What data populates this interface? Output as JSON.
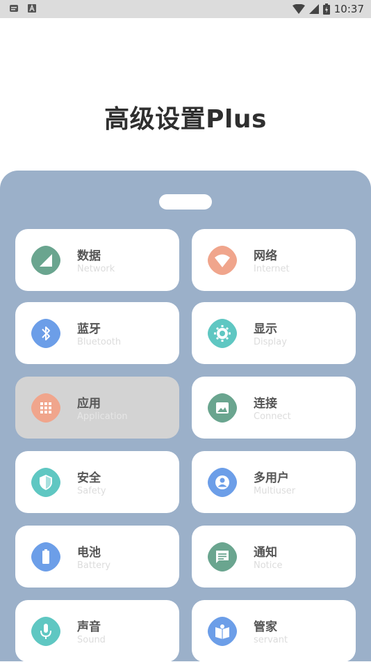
{
  "status_bar": {
    "time": "10:37",
    "icons": [
      "message-icon",
      "a-icon",
      "wifi-icon",
      "signal-icon",
      "battery-icon"
    ]
  },
  "page": {
    "title": "高级设置Plus"
  },
  "colors": {
    "panel": "#9bb0c9",
    "card": "#ffffff",
    "card_active": "#d3d3d3",
    "green": "#6aa58f",
    "orange": "#f0a58c",
    "blue": "#6c9ee8",
    "teal": "#5fc7c2"
  },
  "settings": [
    {
      "title": "数据",
      "subtitle": "Network",
      "icon": "network-icon",
      "color": "#6aa58f"
    },
    {
      "title": "网络",
      "subtitle": "Internet",
      "icon": "wifi-icon",
      "color": "#f0a58c"
    },
    {
      "title": "蓝牙",
      "subtitle": "Bluetooth",
      "icon": "bluetooth-icon",
      "color": "#6c9ee8"
    },
    {
      "title": "显示",
      "subtitle": "Display",
      "icon": "brightness-icon",
      "color": "#5fc7c2"
    },
    {
      "title": "应用",
      "subtitle": "Application",
      "icon": "apps-grid-icon",
      "color": "#f0a58c",
      "active": true
    },
    {
      "title": "连接",
      "subtitle": "Connect",
      "icon": "image-icon",
      "color": "#6aa58f"
    },
    {
      "title": "安全",
      "subtitle": "Safety",
      "icon": "shield-icon",
      "color": "#5fc7c2"
    },
    {
      "title": "多用户",
      "subtitle": "Multiuser",
      "icon": "user-icon",
      "color": "#6c9ee8"
    },
    {
      "title": "电池",
      "subtitle": "Battery",
      "icon": "battery-icon",
      "color": "#6c9ee8"
    },
    {
      "title": "通知",
      "subtitle": "Notice",
      "icon": "message-icon",
      "color": "#6aa58f"
    },
    {
      "title": "声音",
      "subtitle": "Sound",
      "icon": "mic-icon",
      "color": "#5fc7c2"
    },
    {
      "title": "管家",
      "subtitle": "servant",
      "icon": "book-icon",
      "color": "#6c9ee8"
    }
  ]
}
